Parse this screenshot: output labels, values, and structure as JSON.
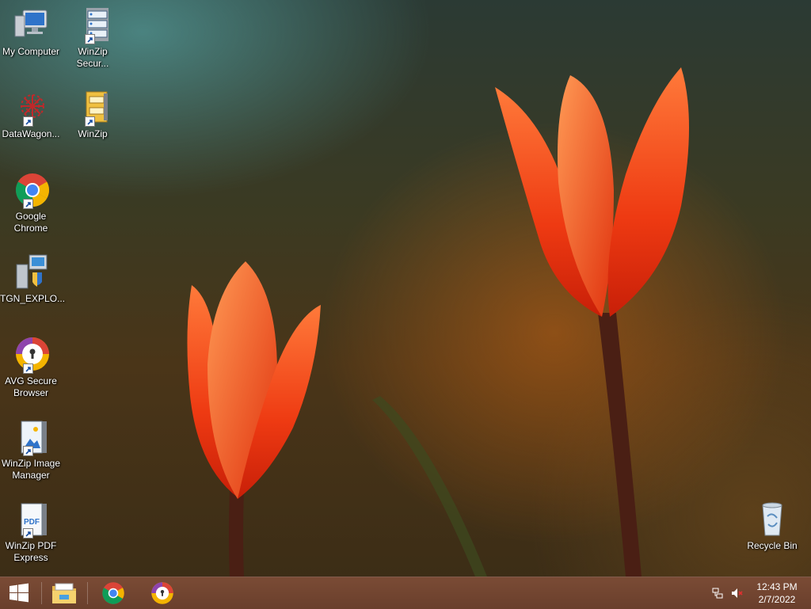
{
  "desktop": {
    "icons": [
      {
        "label": "My Computer",
        "icon": "computer-icon"
      },
      {
        "label": "WinZip Secur...",
        "icon": "winzip-secure-icon"
      },
      {
        "label": "DataWagon...",
        "icon": "datawagon-icon"
      },
      {
        "label": "WinZip",
        "icon": "winzip-icon"
      },
      {
        "label": "Google Chrome",
        "icon": "chrome-icon"
      },
      {
        "label": "TGN_EXPLO...",
        "icon": "installer-icon"
      },
      {
        "label": "AVG Secure Browser",
        "icon": "avg-browser-icon"
      },
      {
        "label": "WinZip Image Manager",
        "icon": "winzip-image-icon"
      },
      {
        "label": "WinZip PDF Express",
        "icon": "winzip-pdf-icon"
      },
      {
        "label": "Recycle Bin",
        "icon": "recycle-bin-icon"
      }
    ]
  },
  "taskbar": {
    "pinned": [
      "start-icon",
      "file-explorer-icon",
      "chrome-icon",
      "avg-browser-icon"
    ],
    "clock": {
      "time": "12:43 PM",
      "date": "2/7/2022"
    },
    "colors": {
      "taskbar": "#6e432f"
    }
  }
}
